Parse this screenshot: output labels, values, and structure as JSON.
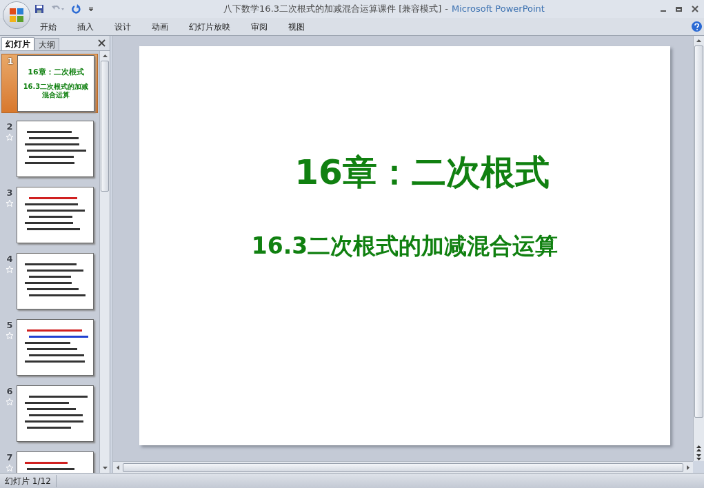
{
  "window": {
    "document_title": "八下数学16.3二次根式的加减混合运算课件 [兼容模式]",
    "separator": "-",
    "app_name": "Microsoft PowerPoint"
  },
  "ribbon_tabs": [
    "开始",
    "插入",
    "设计",
    "动画",
    "幻灯片放映",
    "审阅",
    "视图"
  ],
  "panel_tabs": [
    {
      "label": "幻灯片",
      "selected": true
    },
    {
      "label": "大纲",
      "selected": false
    }
  ],
  "slides": [
    {
      "number": "1",
      "selected": true,
      "animated": false,
      "title": "16章：二次根式",
      "subtitle": "16.3二次根式的加减混合运算"
    },
    {
      "number": "2",
      "selected": false,
      "animated": true
    },
    {
      "number": "3",
      "selected": false,
      "animated": true
    },
    {
      "number": "4",
      "selected": false,
      "animated": true
    },
    {
      "number": "5",
      "selected": false,
      "animated": true
    },
    {
      "number": "6",
      "selected": false,
      "animated": true
    },
    {
      "number": "7",
      "selected": false,
      "animated": true
    }
  ],
  "current_slide": {
    "title": "16章：二次根式",
    "subtitle": "16.3二次根式的加减混合运算"
  },
  "status_bar": {
    "slide_indicator": "幻灯片 1/12"
  }
}
